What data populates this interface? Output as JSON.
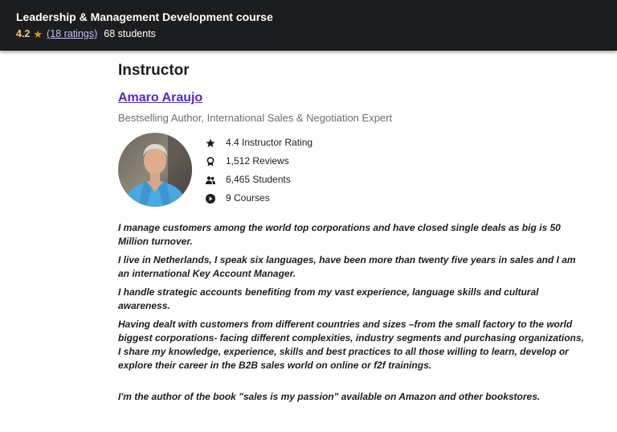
{
  "header": {
    "course_title": "Leadership & Management Development course",
    "rating": "4.2",
    "ratings_link": "(18 ratings)",
    "students": "68 students",
    "star_color": "#e59819",
    "background_color": "#1c1d1f"
  },
  "instructor": {
    "section_title": "Instructor",
    "name": "Amaro Araujo",
    "name_color": "#5624d0",
    "headline": "Bestselling Author, International Sales & Negotiation Expert",
    "stats": [
      {
        "icon": "star-icon",
        "label": "4.4 Instructor Rating"
      },
      {
        "icon": "award-icon",
        "label": "1,512 Reviews"
      },
      {
        "icon": "people-icon",
        "label": "6,465 Students"
      },
      {
        "icon": "play-circle-icon",
        "label": "9 Courses"
      }
    ],
    "bio": [
      "I manage customers among the world top corporations and have closed single deals as big is 50 Million turnover.",
      "I live in Netherlands, I speak six languages, have been more than twenty five years in sales and I am an international Key Account Manager.",
      "I handle strategic accounts benefiting from my vast experience, language skills and cultural awareness.",
      "Having dealt with customers from different countries and sizes –from the small factory to the world biggest corporations- facing different complexities, industry segments and purchasing organizations, I share my knowledge, experience, skills and best practices to all those willing to learn, develop or explore their career in the B2B sales world on online or f2f trainings.",
      "I'm the author of the book \"sales is my passion\" available on Amazon and other bookstores."
    ]
  }
}
